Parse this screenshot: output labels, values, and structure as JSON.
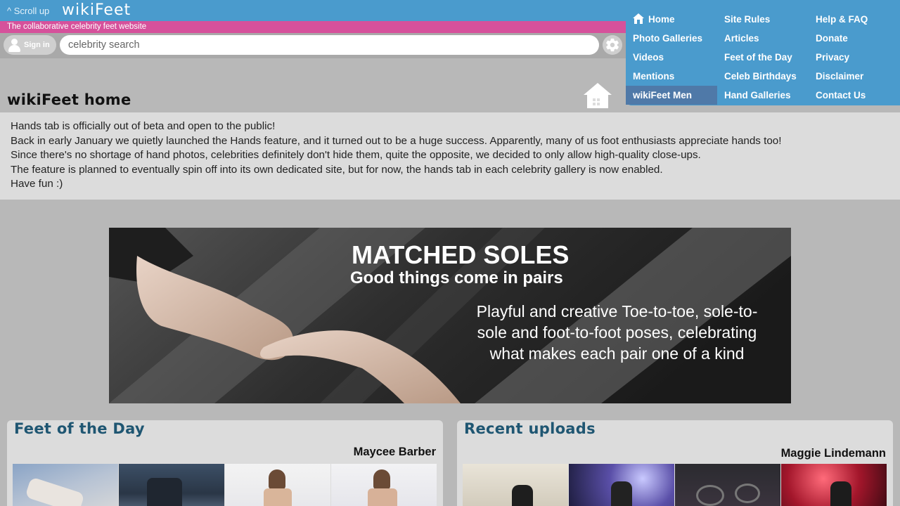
{
  "header": {
    "scroll_up": "^ Scroll up",
    "logo": "wikiFeet",
    "tagline": "The collaborative celebrity feet website"
  },
  "search": {
    "sign_in": "Sign in",
    "placeholder": "celebrity search"
  },
  "nav": {
    "col1": [
      "Home",
      "Photo Galleries",
      "Videos",
      "Mentions",
      "wikiFeet Men"
    ],
    "col2": [
      "Site Rules",
      "Articles",
      "Feet of the Day",
      "Celeb Birthdays",
      "Hand Galleries"
    ],
    "col3": [
      "Help & FAQ",
      "Donate",
      "Privacy",
      "Disclaimer",
      "Contact Us"
    ],
    "active": "wikiFeet Men"
  },
  "page": {
    "title": "wikiFeet home"
  },
  "announcement": {
    "lines": [
      "Hands tab is officially out of beta and open to the public!",
      "Back in early January we quietly launched the Hands feature, and it turned out to be a huge success. Apparently, many of us foot enthusiasts appreciate hands too!",
      "Since there's no shortage of hand photos, celebrities definitely don't hide them, quite the opposite, we decided to only allow high-quality close-ups.",
      "The feature is planned to eventually spin off into its own dedicated site, but for now, the hands tab in each celebrity gallery is now enabled.",
      "Have fun :)"
    ]
  },
  "banner": {
    "title": "MATCHED SOLES",
    "subtitle": "Good things come in pairs",
    "body": "Playful and creative Toe-to-toe, sole-to-sole and foot-to-foot poses, celebrating what makes each pair one of a kind"
  },
  "feet_of_the_day": {
    "heading": "Feet of the Day",
    "name": "Maycee Barber"
  },
  "recent_uploads": {
    "heading": "Recent uploads",
    "name": "Maggie Lindemann"
  },
  "colors": {
    "header_blue": "#4a9bcd",
    "tagline_pink": "#d6519b",
    "active_nav": "#4f79a8",
    "panel_heading": "#1f5672",
    "page_bg": "#b8b8b8"
  }
}
